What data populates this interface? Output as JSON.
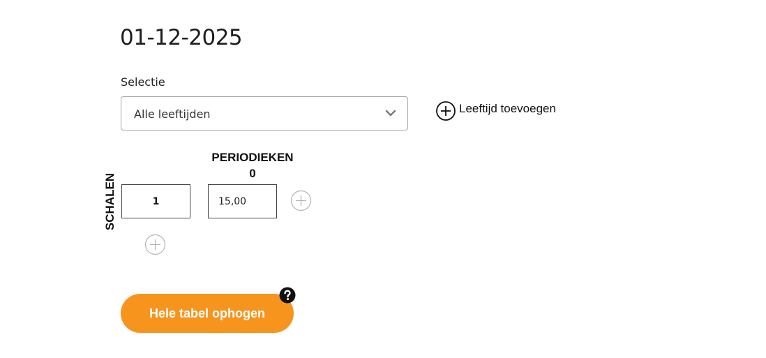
{
  "header": {
    "date": "01-12-2025"
  },
  "selection": {
    "label": "Selectie",
    "value": "Alle leeftijden",
    "add_age_label": "Leeftijd toevoegen"
  },
  "table": {
    "column_header_line1": "PERIODIEKEN",
    "column_header_line2": "0",
    "row_header": "SCHALEN",
    "rows": [
      {
        "scale": "1",
        "value": "15,00"
      }
    ]
  },
  "actions": {
    "raise_button_label": "Hele tabel ophogen"
  },
  "icons": {
    "add_age": "plus-circle-icon",
    "add_column": "plus-circle-icon",
    "add_row": "plus-circle-icon",
    "select_toggle": "chevron-down-icon",
    "help": "question-circle-icon"
  },
  "colors": {
    "accent": "#f7941d",
    "border": "#a6a6a6",
    "muted_icon": "#b5b5b5"
  }
}
